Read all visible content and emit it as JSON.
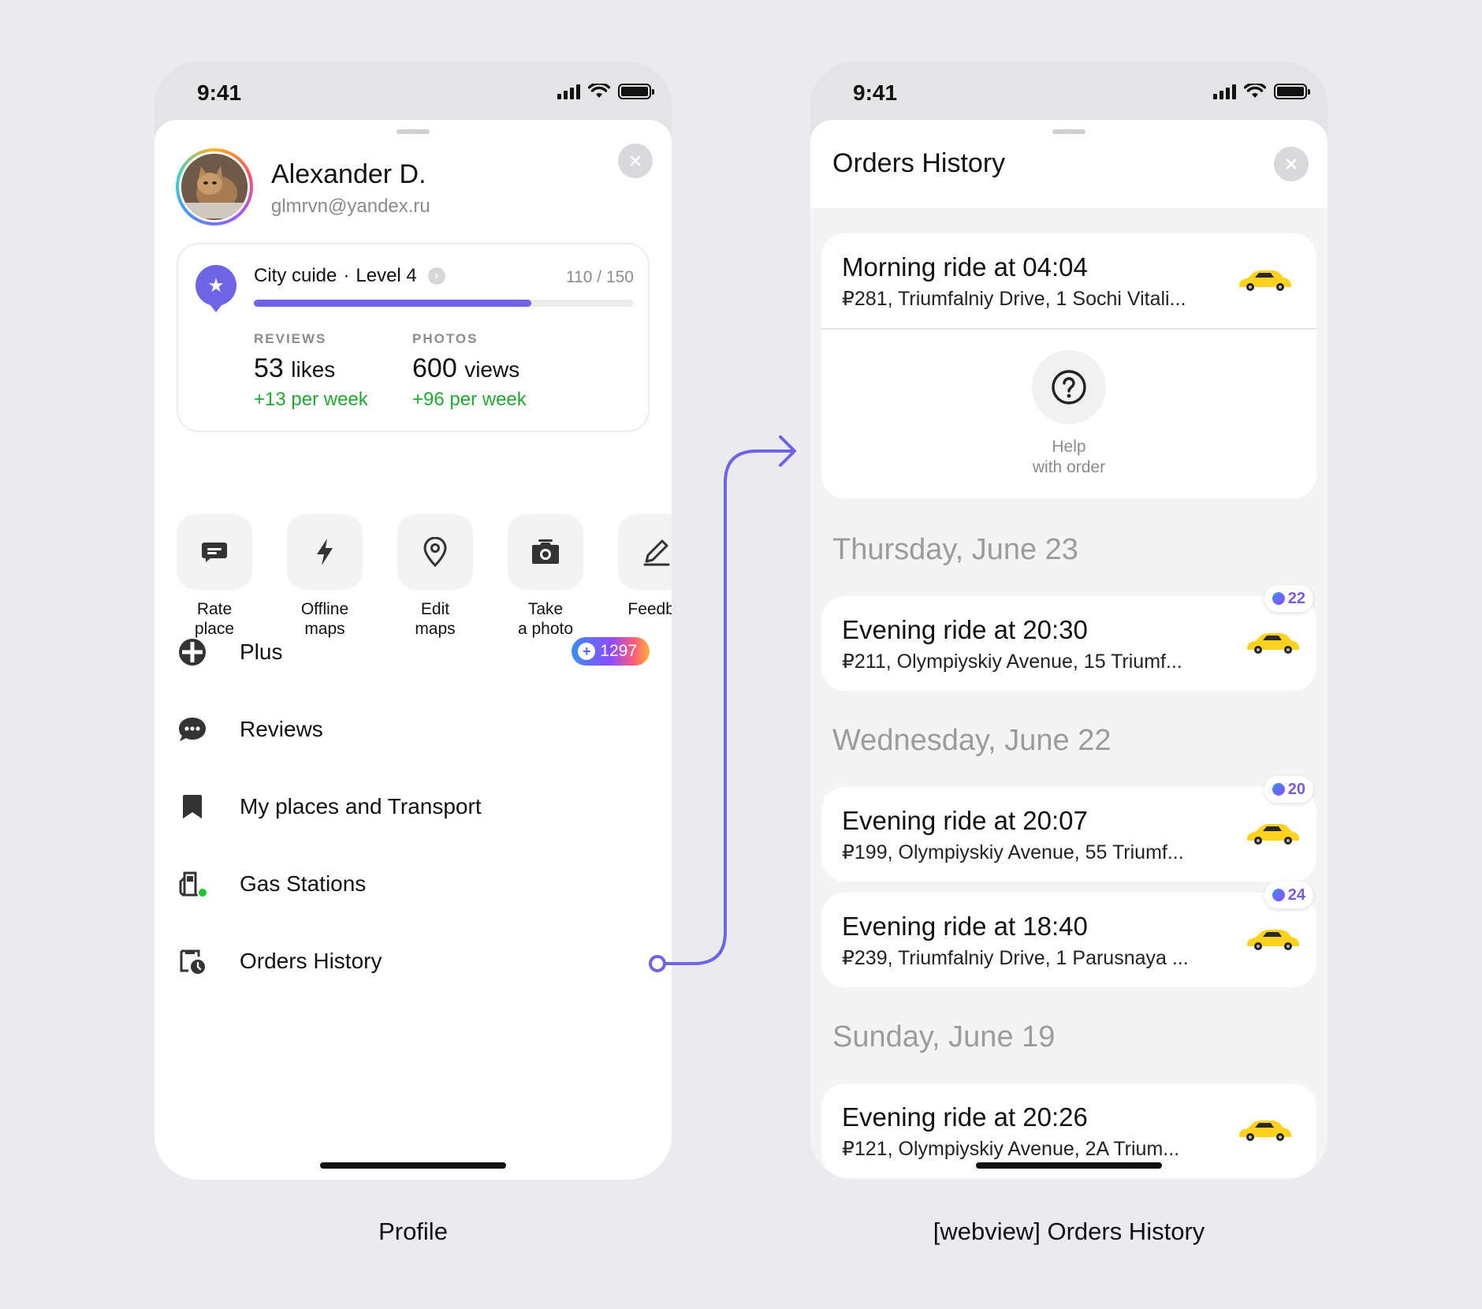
{
  "profile_screen": {
    "status_time": "9:41",
    "user": {
      "name": "Alexander D.",
      "email": "glmrvn@yandex.ru"
    },
    "guide": {
      "title": "City cuide",
      "separator": "·",
      "level": "Level 4",
      "progress_text": "110 / 150",
      "progress_fraction": 0.73,
      "stats": [
        {
          "label": "REVIEWS",
          "value": "53",
          "unit": "likes",
          "delta": "+13 per week"
        },
        {
          "label": "PHOTOS",
          "value": "600",
          "unit": "views",
          "delta": "+96 per week"
        }
      ]
    },
    "actions": [
      {
        "label": "Rate\nplace",
        "icon": "chat-bubble-icon"
      },
      {
        "label": "Offline\nmaps",
        "icon": "lightning-icon"
      },
      {
        "label": "Edit\nmaps",
        "icon": "map-pin-icon"
      },
      {
        "label": "Take\na photo",
        "icon": "camera-icon"
      },
      {
        "label": "Feedba",
        "icon": "pencil-icon"
      }
    ],
    "menu": [
      {
        "label": "Plus",
        "icon": "plus-icon",
        "badge": "1297"
      },
      {
        "label": "Reviews",
        "icon": "comments-icon"
      },
      {
        "label": "My places and Transport",
        "icon": "bookmark-icon"
      },
      {
        "label": "Gas Stations",
        "icon": "gas-station-icon"
      },
      {
        "label": "Orders History",
        "icon": "orders-history-icon"
      }
    ]
  },
  "orders_screen": {
    "status_time": "9:41",
    "title": "Orders History",
    "current_order": {
      "title": "Morning ride at 04:04",
      "subtitle": "₽281, Triumfalniy Drive, 1 Sochi Vitali...",
      "help_label": "Help\nwith order"
    },
    "groups": [
      {
        "date": "Thursday, June 23",
        "orders": [
          {
            "title": "Evening ride at 20:30",
            "subtitle": "₽211, Olympiyskiy Avenue, 15 Triumf...",
            "points": "22"
          }
        ]
      },
      {
        "date": "Wednesday, June 22",
        "orders": [
          {
            "title": "Evening ride at 20:07",
            "subtitle": "₽199, Olympiyskiy Avenue, 55 Triumf...",
            "points": "20"
          },
          {
            "title": "Evening ride at 18:40",
            "subtitle": "₽239, Triumfalniy Drive, 1 Parusnaya ...",
            "points": "24"
          }
        ]
      },
      {
        "date": "Sunday, June 19",
        "orders": [
          {
            "title": "Evening ride at 20:26",
            "subtitle": "₽121, Olympiyskiy Avenue, 2A Trium..."
          }
        ]
      }
    ]
  },
  "captions": {
    "left": "Profile",
    "right": "[webview] Orders History"
  },
  "colors": {
    "accent": "#6e64e6",
    "positive": "#22a832",
    "background": "#ebebef",
    "taxi": "#ffd21f"
  }
}
